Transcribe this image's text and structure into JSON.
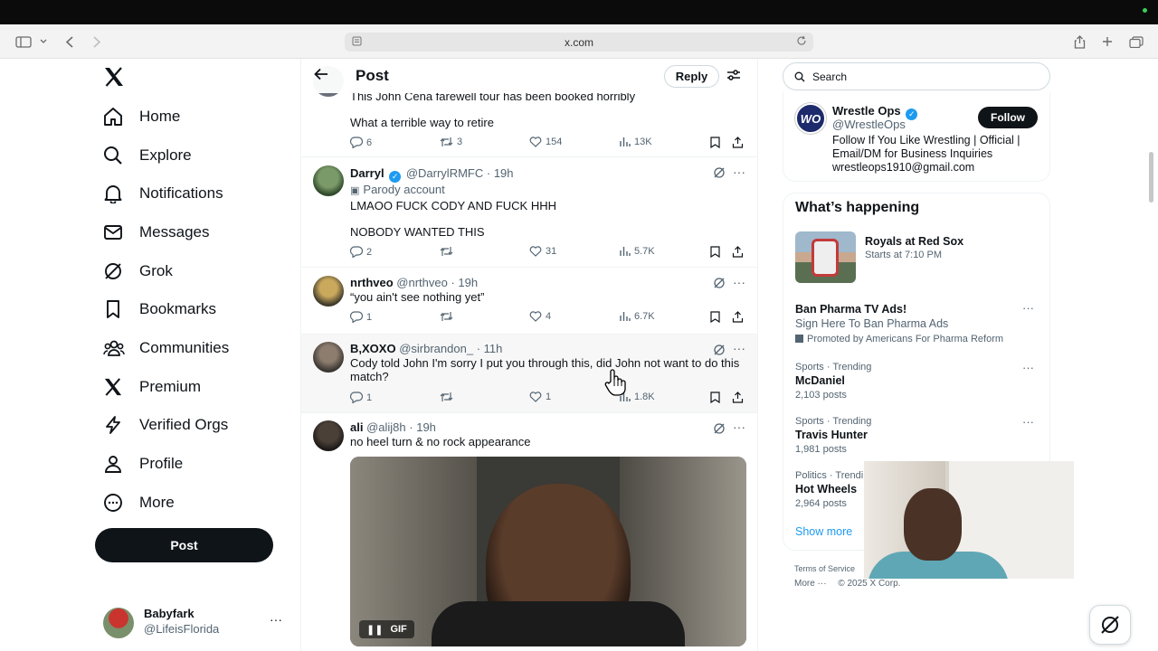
{
  "browser": {
    "url": "x.com"
  },
  "nav": {
    "items": [
      {
        "label": "Home",
        "icon": "home-icon"
      },
      {
        "label": "Explore",
        "icon": "search-icon"
      },
      {
        "label": "Notifications",
        "icon": "bell-icon"
      },
      {
        "label": "Messages",
        "icon": "mail-icon"
      },
      {
        "label": "Grok",
        "icon": "grok-icon"
      },
      {
        "label": "Bookmarks",
        "icon": "bookmark-icon"
      },
      {
        "label": "Communities",
        "icon": "people-icon"
      },
      {
        "label": "Premium",
        "icon": "x-icon"
      },
      {
        "label": "Verified Orgs",
        "icon": "lightning-icon"
      },
      {
        "label": "Profile",
        "icon": "person-icon"
      },
      {
        "label": "More",
        "icon": "more-circle-icon"
      }
    ],
    "post_label": "Post"
  },
  "account": {
    "name": "Babyfark",
    "handle": "@LifeisFlorida",
    "more": "···"
  },
  "header": {
    "title": "Post",
    "reply_label": "Reply"
  },
  "tweets": [
    {
      "text1": "This John Cena farewell tour has been booked horribly",
      "text2": "What a terrible way to retire",
      "replies": "6",
      "retweets": "3",
      "likes": "154",
      "views": "13K"
    },
    {
      "name": "Darryl",
      "handle": "@DarrylRMFC",
      "time": "· 19h",
      "label": "Parody account",
      "text1": "LMAOO FUCK CODY AND FUCK HHH",
      "text2": "NOBODY WANTED THIS",
      "replies": "2",
      "retweets": "",
      "likes": "31",
      "views": "5.7K"
    },
    {
      "name": "nrthveo",
      "handle": "@nrthveo",
      "time": "· 19h",
      "text1": "“you ain't see nothing yet”",
      "replies": "1",
      "retweets": "",
      "likes": "4",
      "views": "6.7K"
    },
    {
      "name": "B,XOXO",
      "handle": "@sirbrandon_",
      "time": "· 11h",
      "text1": "Cody told John I'm sorry I put you through this, did John not want to do this match?",
      "replies": "1",
      "retweets": "",
      "likes": "1",
      "views": "1.8K"
    },
    {
      "name": "ali",
      "handle": "@alij8h",
      "time": "· 19h",
      "text1": "no heel turn & no rock appearance",
      "gif_label": "GIF"
    }
  ],
  "sidebar": {
    "search_placeholder": "Search",
    "suggested": {
      "logo_text": "WO",
      "name": "Wrestle Ops",
      "handle": "@WrestleOps",
      "follow_label": "Follow",
      "bio": "Follow If You Like Wrestling | Official | Email/DM for Business Inquiries wrestleops1910@gmail.com"
    },
    "whats_happening": {
      "title": "What’s happening",
      "event": {
        "title": "Royals at Red Sox",
        "sub": "Starts at 7:10 PM"
      },
      "promo": {
        "title": "Ban Pharma TV Ads!",
        "sub": "Sign Here To Ban Pharma Ads",
        "promoted": "Promoted by Americans For Pharma Reform"
      },
      "trends": [
        {
          "category": "Sports · Trending",
          "title": "McDaniel",
          "posts": "2,103 posts"
        },
        {
          "category": "Sports · Trending",
          "title": "Travis Hunter",
          "posts": "1,981 posts"
        },
        {
          "category": "Politics · Trendi",
          "title": "Hot Wheels",
          "posts": "2,964 posts"
        }
      ],
      "show_more": "Show more"
    },
    "footer": {
      "terms": "Terms of Service",
      "more": "More ···",
      "copyright": "© 2025 X Corp."
    }
  },
  "colors": {
    "accent": "#1d9bf0",
    "text": "#0f1419",
    "muted": "#536471"
  }
}
